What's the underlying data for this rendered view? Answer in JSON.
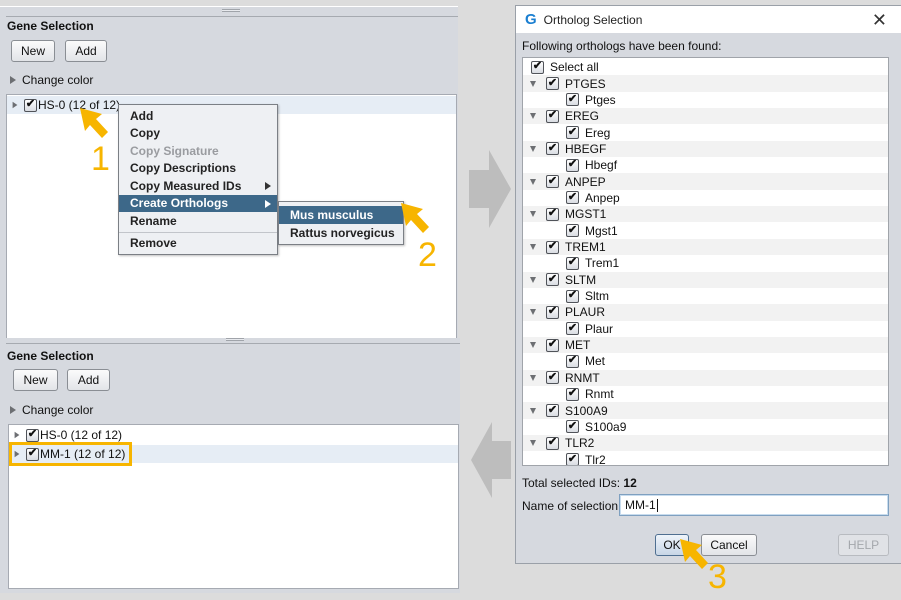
{
  "top_panel": {
    "title": "Gene Selection",
    "new_label": "New",
    "add_label": "Add",
    "change_color_label": "Change color",
    "tree_items": [
      {
        "label": "HS-0 (12 of 12)",
        "checked": true
      }
    ]
  },
  "context_menu": {
    "items": [
      {
        "label": "Add",
        "disabled": false
      },
      {
        "label": "Copy",
        "disabled": false
      },
      {
        "label": "Copy Signature",
        "disabled": true
      },
      {
        "label": "Copy Descriptions",
        "disabled": false
      },
      {
        "label": "Copy Measured IDs",
        "disabled": false,
        "submenu": true
      },
      {
        "label": "Create Orthologs",
        "disabled": false,
        "submenu": true,
        "active": true
      },
      {
        "label": "Rename",
        "disabled": false
      },
      {
        "label": "Remove",
        "disabled": false
      }
    ],
    "submenu_items": [
      {
        "label": "Mus musculus",
        "active": true
      },
      {
        "label": "Rattus norvegicus",
        "active": false
      }
    ]
  },
  "bottom_panel": {
    "title": "Gene Selection",
    "new_label": "New",
    "add_label": "Add",
    "change_color_label": "Change color",
    "tree_items": [
      {
        "label": "HS-0 (12 of 12)",
        "checked": true
      },
      {
        "label": "MM-1 (12 of 12)",
        "checked": true,
        "highlighted": true
      }
    ]
  },
  "dialog": {
    "logo": "G",
    "title": "Ortholog Selection",
    "close_icon": "close-icon",
    "intro": "Following orthologs have been found:",
    "select_all_label": "Select all",
    "orthologs": [
      {
        "human": "PTGES",
        "mouse": "Ptges"
      },
      {
        "human": "EREG",
        "mouse": "Ereg"
      },
      {
        "human": "HBEGF",
        "mouse": "Hbegf"
      },
      {
        "human": "ANPEP",
        "mouse": "Anpep"
      },
      {
        "human": "MGST1",
        "mouse": "Mgst1"
      },
      {
        "human": "TREM1",
        "mouse": "Trem1"
      },
      {
        "human": "SLTM",
        "mouse": "Sltm"
      },
      {
        "human": "PLAUR",
        "mouse": "Plaur"
      },
      {
        "human": "MET",
        "mouse": "Met"
      },
      {
        "human": "RNMT",
        "mouse": "Rnmt"
      },
      {
        "human": "S100A9",
        "mouse": "S100a9"
      },
      {
        "human": "TLR2",
        "mouse": "Tlr2"
      }
    ],
    "total_label": "Total selected IDs:",
    "total_value": "12",
    "name_label": "Name of selection:",
    "name_value": "MM-1",
    "ok_label": "OK",
    "cancel_label": "Cancel",
    "help_label": "HELP"
  },
  "annotations": {
    "step1": "1",
    "step2": "2",
    "step3": "3",
    "accent_color": "#f7b500",
    "arrow_color": "#bdbdbd"
  }
}
